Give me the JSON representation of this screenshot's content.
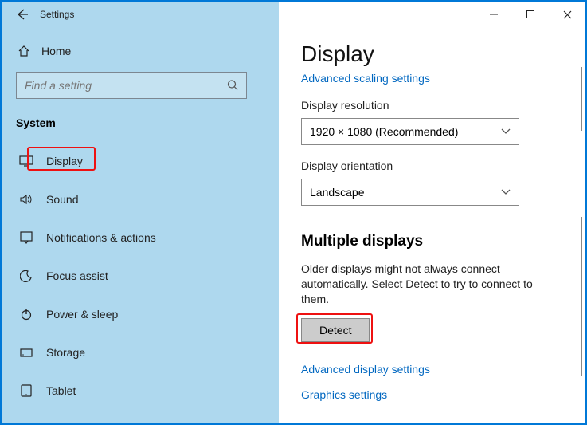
{
  "titlebar": {
    "app": "Settings"
  },
  "sidebar": {
    "home": "Home",
    "search_placeholder": "Find a setting",
    "category": "System",
    "items": [
      {
        "label": "Display"
      },
      {
        "label": "Sound"
      },
      {
        "label": "Notifications & actions"
      },
      {
        "label": "Focus assist"
      },
      {
        "label": "Power & sleep"
      },
      {
        "label": "Storage"
      },
      {
        "label": "Tablet"
      }
    ]
  },
  "main": {
    "heading": "Display",
    "scaling_link": "Advanced scaling settings",
    "resolution_label": "Display resolution",
    "resolution_value": "1920 × 1080 (Recommended)",
    "orientation_label": "Display orientation",
    "orientation_value": "Landscape",
    "multi_heading": "Multiple displays",
    "multi_desc": "Older displays might not always connect automatically. Select Detect to try to connect to them.",
    "detect_btn": "Detect",
    "adv_display_link": "Advanced display settings",
    "graphics_link": "Graphics settings"
  }
}
